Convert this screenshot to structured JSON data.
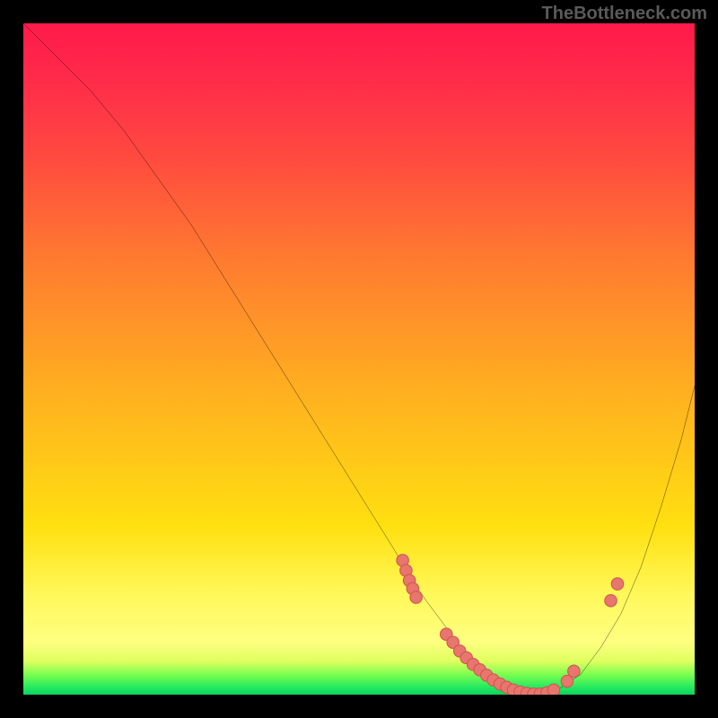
{
  "watermark": "TheBottleneck.com",
  "chart_data": {
    "type": "line",
    "title": "",
    "xlabel": "",
    "ylabel": "",
    "xlim": [
      0,
      100
    ],
    "ylim": [
      0,
      100
    ],
    "curve": {
      "x": [
        0,
        5,
        10,
        15,
        20,
        25,
        30,
        35,
        40,
        45,
        50,
        55,
        58,
        60,
        63,
        66,
        69,
        72,
        75,
        78,
        80,
        83,
        86,
        89,
        92,
        95,
        98,
        100
      ],
      "y": [
        100,
        95,
        90,
        84,
        77,
        70,
        62,
        54,
        46,
        38,
        30,
        22,
        17,
        14,
        10,
        6,
        3,
        1,
        0,
        0,
        1,
        3,
        7,
        12,
        19,
        28,
        38,
        46
      ]
    },
    "scatter_points": [
      {
        "x": 56.5,
        "y": 20.0
      },
      {
        "x": 57.0,
        "y": 18.5
      },
      {
        "x": 57.5,
        "y": 17.0
      },
      {
        "x": 58.0,
        "y": 15.8
      },
      {
        "x": 58.5,
        "y": 14.5
      },
      {
        "x": 63.0,
        "y": 9.0
      },
      {
        "x": 64.0,
        "y": 7.8
      },
      {
        "x": 65.0,
        "y": 6.5
      },
      {
        "x": 66.0,
        "y": 5.5
      },
      {
        "x": 67.0,
        "y": 4.5
      },
      {
        "x": 68.0,
        "y": 3.7
      },
      {
        "x": 69.0,
        "y": 2.9
      },
      {
        "x": 70.0,
        "y": 2.2
      },
      {
        "x": 71.0,
        "y": 1.6
      },
      {
        "x": 72.0,
        "y": 1.1
      },
      {
        "x": 73.0,
        "y": 0.7
      },
      {
        "x": 74.0,
        "y": 0.4
      },
      {
        "x": 75.0,
        "y": 0.2
      },
      {
        "x": 76.0,
        "y": 0.1
      },
      {
        "x": 77.0,
        "y": 0.1
      },
      {
        "x": 78.0,
        "y": 0.3
      },
      {
        "x": 79.0,
        "y": 0.7
      },
      {
        "x": 81.0,
        "y": 2.0
      },
      {
        "x": 82.0,
        "y": 3.5
      },
      {
        "x": 87.5,
        "y": 14.0
      },
      {
        "x": 88.5,
        "y": 16.5
      }
    ],
    "colors": {
      "curve": "#000000",
      "points_fill": "#e8766f",
      "points_stroke": "#d05850",
      "gradient_top": "#ff1a4a",
      "gradient_bottom": "#10d060"
    }
  }
}
